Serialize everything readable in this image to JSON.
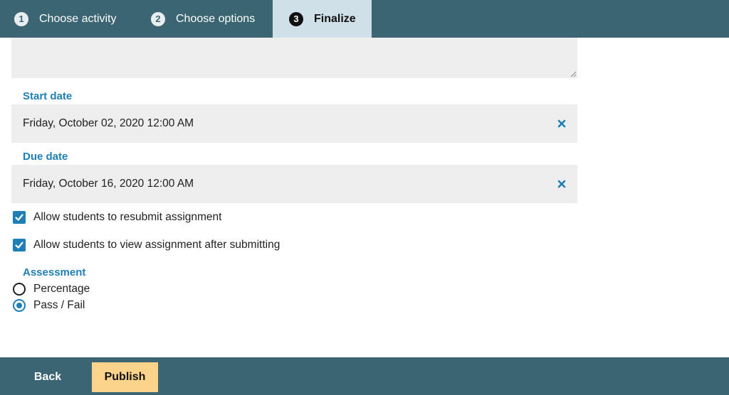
{
  "steps": [
    {
      "number": "1",
      "label": "Choose activity"
    },
    {
      "number": "2",
      "label": "Choose options"
    },
    {
      "number": "3",
      "label": "Finalize"
    }
  ],
  "form": {
    "start_date_label": "Start date",
    "start_date_value": "Friday, October 02, 2020 12:00 AM",
    "due_date_label": "Due date",
    "due_date_value": "Friday, October 16, 2020 12:00 AM",
    "clear_glyph": "✕",
    "checkboxes": [
      {
        "label": "Allow students to resubmit assignment",
        "checked": true
      },
      {
        "label": "Allow students to view assignment after submitting",
        "checked": true
      }
    ],
    "assessment_label": "Assessment",
    "assessment_options": [
      {
        "label": "Percentage",
        "selected": false
      },
      {
        "label": "Pass / Fail",
        "selected": true
      }
    ]
  },
  "footer": {
    "back_label": "Back",
    "publish_label": "Publish"
  },
  "colors": {
    "bar": "#3b6573",
    "accent": "#1e7fb6",
    "publish": "#fbd38a",
    "active_step": "#cfe0e8"
  }
}
